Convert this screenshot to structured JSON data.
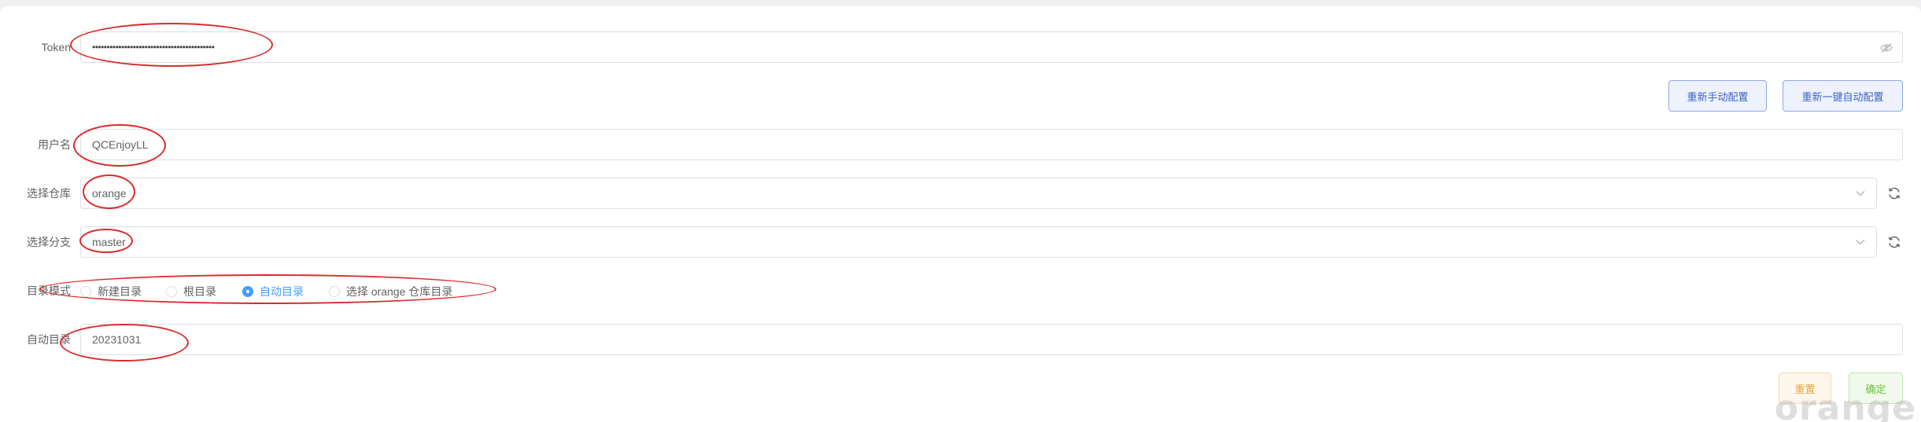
{
  "form": {
    "token": {
      "label": "Token",
      "value": "••••••••••••••••••••••••••••••••••••••••••"
    },
    "reconfig_manual_label": "重新手动配置",
    "reconfig_auto_label": "重新一键自动配置",
    "username": {
      "label": "用户名",
      "value": "QCEnjoyLL"
    },
    "repo": {
      "label": "选择仓库",
      "value": "orange"
    },
    "branch": {
      "label": "选择分支",
      "value": "master"
    },
    "dir_mode": {
      "label": "目录模式",
      "options": [
        {
          "label": "新建目录",
          "checked": false
        },
        {
          "label": "根目录",
          "checked": false
        },
        {
          "label": "自动目录",
          "checked": true
        },
        {
          "label": "选择 orange 仓库目录",
          "checked": false
        }
      ]
    },
    "auto_dir": {
      "label": "自动目录",
      "value": "20231031"
    },
    "reset_label": "重置",
    "confirm_label": "确定"
  },
  "watermark": "orange",
  "icons": {
    "token_suffix": "eye-off-icon",
    "select_suffix": "chevron-down-icon",
    "refresh": "refresh-icon"
  },
  "colors": {
    "annotation": "#d92b2b",
    "primary": "#409eff",
    "warning": "#e6a23c",
    "success": "#67c23a"
  }
}
